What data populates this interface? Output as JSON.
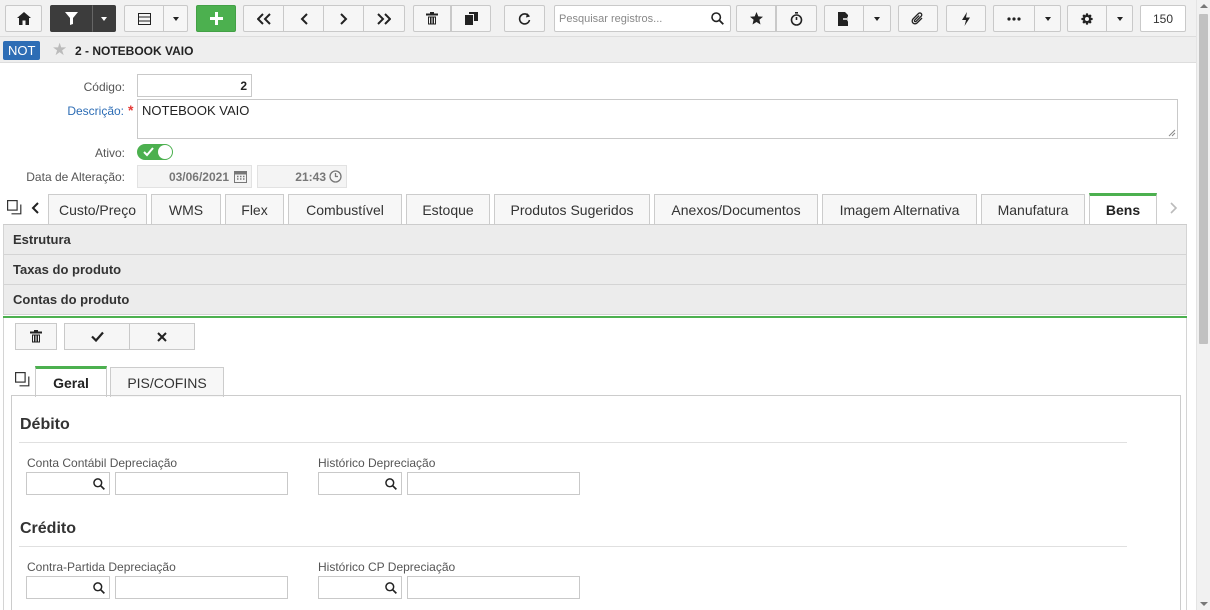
{
  "toolbar": {
    "search_placeholder": "Pesquisar registros...",
    "page_size": "150"
  },
  "record": {
    "badge": "NOT",
    "title": "2 - NOTEBOOK VAIO"
  },
  "form": {
    "codigo_label": "Código:",
    "codigo_value": "2",
    "descricao_label": "Descrição:",
    "required_mark": "*",
    "descricao_value": "NOTEBOOK VAIO",
    "ativo_label": "Ativo:",
    "ativo_value": true,
    "data_alteracao_label": "Data de Alteração:",
    "data_value": "03/06/2021",
    "hora_value": "21:43"
  },
  "tabs": [
    {
      "label": "Custo/Preço"
    },
    {
      "label": "WMS"
    },
    {
      "label": "Flex"
    },
    {
      "label": "Combustível"
    },
    {
      "label": "Estoque"
    },
    {
      "label": "Produtos Sugeridos"
    },
    {
      "label": "Anexos/Documentos"
    },
    {
      "label": "Imagem Alternativa"
    },
    {
      "label": "Manufatura"
    },
    {
      "label": "Bens",
      "active": true
    }
  ],
  "sections": [
    {
      "label": "Estrutura"
    },
    {
      "label": "Taxas do produto"
    },
    {
      "label": "Contas do produto"
    }
  ],
  "inner_tabs": [
    {
      "label": "Geral",
      "active": true
    },
    {
      "label": "PIS/COFINS"
    }
  ],
  "debito": {
    "heading": "Débito",
    "conta_label": "Conta Contábil Depreciação",
    "historico_label": "Histórico Depreciação"
  },
  "credito": {
    "heading": "Crédito",
    "contra_label": "Contra-Partida Depreciação",
    "historico_label": "Histórico CP Depreciação"
  },
  "colors": {
    "accent_green": "#4cb04f",
    "badge_blue": "#2d6db5",
    "required_red": "#e53935"
  }
}
